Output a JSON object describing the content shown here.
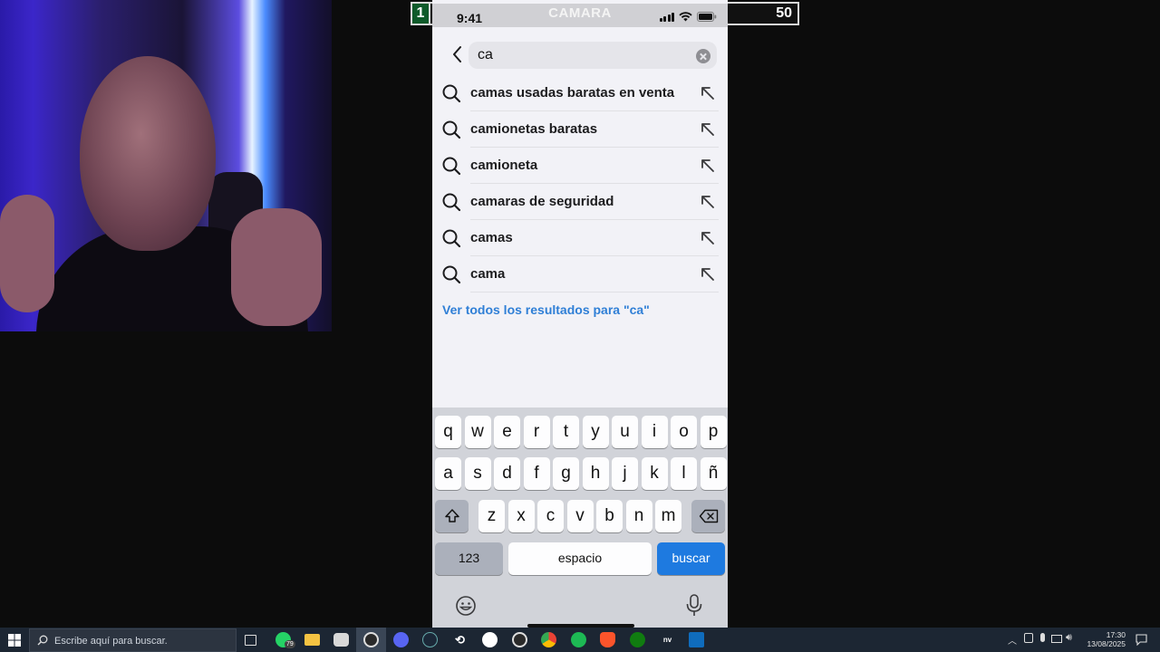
{
  "overlay": {
    "left_badge": "1",
    "title": "CAMARA",
    "right_badge": "50"
  },
  "status": {
    "time": "9:41"
  },
  "search": {
    "value": "ca"
  },
  "suggestions": [
    "camas usadas baratas en venta",
    "camionetas baratas",
    "camioneta",
    "camaras de seguridad",
    "camas",
    "cama"
  ],
  "see_all": "Ver todos los resultados para \"ca\"",
  "keyboard": {
    "row1": [
      "q",
      "w",
      "e",
      "r",
      "t",
      "y",
      "u",
      "i",
      "o",
      "p"
    ],
    "row2": [
      "a",
      "s",
      "d",
      "f",
      "g",
      "h",
      "j",
      "k",
      "l",
      "ñ"
    ],
    "row3": [
      "z",
      "x",
      "c",
      "v",
      "b",
      "n",
      "m"
    ],
    "numbers_label": "123",
    "space_label": "espacio",
    "action_label": "buscar"
  },
  "taskbar": {
    "search_placeholder": "Escribe aquí para buscar.",
    "whatsapp_badge": "79",
    "time": "17:30",
    "date": "13/08/2025",
    "app_icons": [
      "task-view",
      "whatsapp",
      "file-explorer",
      "store",
      "obs",
      "discord",
      "steam",
      "epic",
      "app",
      "obs-alt",
      "chrome",
      "spotify",
      "brave",
      "xbox",
      "nvidia",
      "outlook"
    ],
    "accent_colors": {
      "whatsapp": "#25d366",
      "chrome": "#fbbc05",
      "spotify": "#1db954",
      "brave": "#fb542b",
      "xbox": "#107c10",
      "discord": "#5865f2"
    }
  },
  "colors": {
    "link": "#2f7fd6",
    "action_key": "#1e7ae0"
  }
}
